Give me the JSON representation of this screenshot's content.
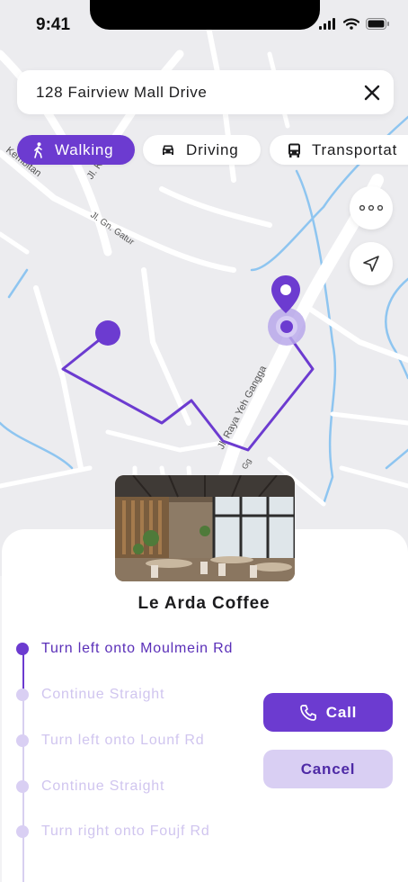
{
  "status_bar": {
    "time": "9:41"
  },
  "search": {
    "address": "128 Fairview Mall Drive"
  },
  "modes": [
    {
      "label": "Walking",
      "icon": "walking-icon",
      "active": true
    },
    {
      "label": "Driving",
      "icon": "car-icon",
      "active": false
    },
    {
      "label": "Transportat",
      "icon": "bus-icon",
      "active": false
    }
  ],
  "map": {
    "street_labels": [
      "Kembitan",
      "Jl. K",
      "Jl. Gn. Gatur",
      "Jl. Raya Yeh Gangga",
      "Gg"
    ]
  },
  "place": {
    "name": "Le Arda Coffee"
  },
  "steps": [
    {
      "text": "Turn left onto Moulmein Rd",
      "active": true
    },
    {
      "text": "Continue Straight",
      "active": false
    },
    {
      "text": "Turn left onto Lounf Rd",
      "active": false
    },
    {
      "text": "Continue Straight",
      "active": false
    },
    {
      "text": "Turn right onto Foujf Rd",
      "active": false
    }
  ],
  "actions": {
    "call_label": "Call",
    "cancel_label": "Cancel"
  },
  "colors": {
    "accent": "#6c3bd0",
    "accent_light": "#d9cff3",
    "water": "#8ec5f0",
    "road": "#ffffff"
  }
}
